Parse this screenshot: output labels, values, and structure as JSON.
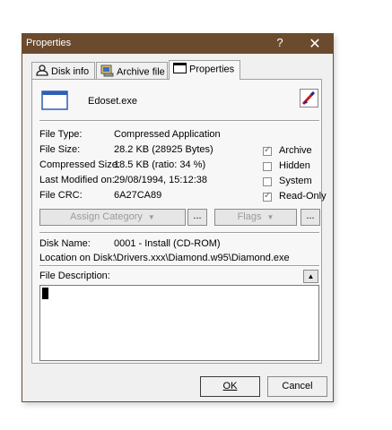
{
  "window": {
    "title": "Properties",
    "help_glyph": "?",
    "close_glyph": "✕"
  },
  "tabs": [
    {
      "label": "Disk info",
      "icon": "disk-icon"
    },
    {
      "label": "Archive file",
      "icon": "archive-icon"
    },
    {
      "label": "Properties",
      "icon": "window-icon",
      "active": true
    }
  ],
  "file": {
    "name": "Edoset.exe",
    "icon": "window-icon"
  },
  "info": {
    "file_type": {
      "label": "File Type:",
      "value": "Compressed Application"
    },
    "file_size": {
      "label": "File Size:",
      "value": "28.2 KB  (28925 Bytes)"
    },
    "compressed_size": {
      "label": "Compressed Size:",
      "value": "18.5 KB  (ratio: 34 %)"
    },
    "last_modified": {
      "label": "Last Modified on:",
      "value": "29/08/1994, 15:12:38"
    },
    "file_crc": {
      "label": "File CRC:",
      "value": "6A27CA89"
    }
  },
  "attributes": [
    {
      "label": "Archive",
      "checked": true
    },
    {
      "label": "Hidden",
      "checked": false
    },
    {
      "label": "System",
      "checked": false
    },
    {
      "label": "Read-Only",
      "checked": true
    }
  ],
  "category": {
    "button_label": "Assign Category",
    "more_label": "...",
    "flags_label": "Flags",
    "flags_more_label": "..."
  },
  "disk": {
    "name": {
      "label": "Disk Name:",
      "value": "0001 - Install (CD-ROM)"
    },
    "location": {
      "label": "Location on Disk:",
      "value": "\\Drivers.xxx\\Diamond.w95\\Diamond.exe"
    }
  },
  "description": {
    "label": "File Description:",
    "toggle_glyph": "▲",
    "value": ""
  },
  "buttons": {
    "ok": "OK",
    "cancel": "Cancel"
  },
  "colors": {
    "titlebar": "#6b4b2d",
    "background": "#f0f0f0"
  }
}
